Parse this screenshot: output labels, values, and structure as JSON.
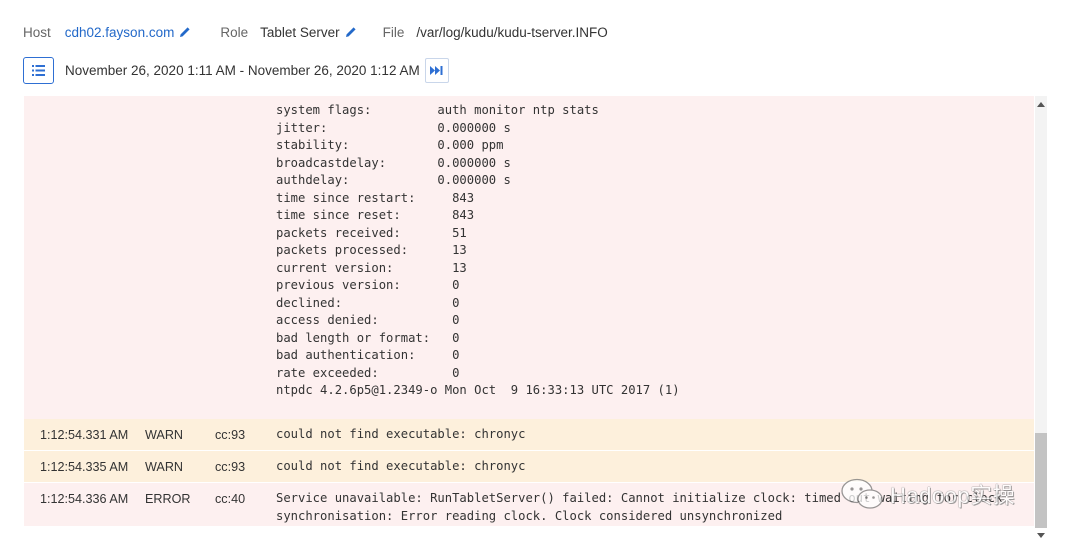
{
  "header": {
    "host_label": "Host",
    "host_value": "cdh02.fayson.com",
    "role_label": "Role",
    "role_value": "Tablet Server",
    "file_label": "File",
    "file_value": "/var/log/kudu/kudu-tserver.INFO"
  },
  "range": {
    "text": "November 26, 2020 1:11 AM - November 26, 2020 1:12 AM"
  },
  "log": {
    "first_entry_lines": [
      "system flags:         auth monitor ntp stats",
      "jitter:               0.000000 s",
      "stability:            0.000 ppm",
      "broadcastdelay:       0.000000 s",
      "authdelay:            0.000000 s",
      "time since restart:     843",
      "time since reset:       843",
      "packets received:       51",
      "packets processed:      13",
      "current version:        13",
      "previous version:       0",
      "declined:               0",
      "access denied:          0",
      "bad length or format:   0",
      "bad authentication:     0",
      "rate exceeded:          0",
      "ntpdc 4.2.6p5@1.2349-o Mon Oct  9 16:33:13 UTC 2017 (1)"
    ],
    "rows": [
      {
        "time": "1:12:54.331 AM",
        "level": "WARN",
        "source": "cc:93",
        "message": "could not find executable: chronyc"
      },
      {
        "time": "1:12:54.335 AM",
        "level": "WARN",
        "source": "cc:93",
        "message": "could not find executable: chronyc"
      },
      {
        "time": "1:12:54.336 AM",
        "level": "ERROR",
        "source": "cc:40",
        "message": "Service unavailable: RunTabletServer() failed: Cannot initialize clock: timed out waiting for clock\nsynchronisation: Error reading clock. Clock considered unsynchronized"
      }
    ]
  },
  "watermark": {
    "text": "Hadoop实操",
    "icon": "wechat-icon"
  },
  "colors": {
    "link": "#2369c9",
    "accent": "#2e6fd3",
    "error_bg": "#fdf0f0",
    "warn_bg": "#fdf0dc"
  }
}
